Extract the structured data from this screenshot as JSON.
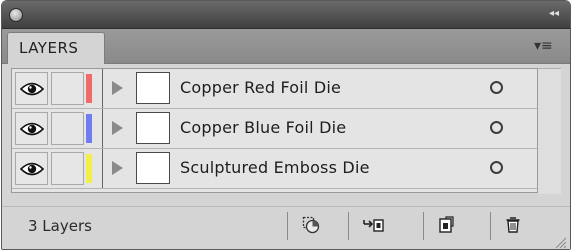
{
  "window": {
    "collapse_glyph": "◂◂"
  },
  "panel": {
    "tab_label": "LAYERS",
    "menu_glyph": "▾≡"
  },
  "layers": [
    {
      "name": "Copper Red Foil Die",
      "color": "#f06a6a",
      "visible": true,
      "locked": false
    },
    {
      "name": "Copper Blue Foil Die",
      "color": "#6f7cf2",
      "visible": true,
      "locked": false
    },
    {
      "name": "Sculptured Emboss Die",
      "color": "#f2ee4a",
      "visible": true,
      "locked": false
    }
  ],
  "footer": {
    "layer_count": "3 Layers",
    "buttons": [
      "make-clipping-mask-icon",
      "create-sublayer-icon",
      "create-new-layer-icon",
      "delete-layer-icon"
    ]
  }
}
